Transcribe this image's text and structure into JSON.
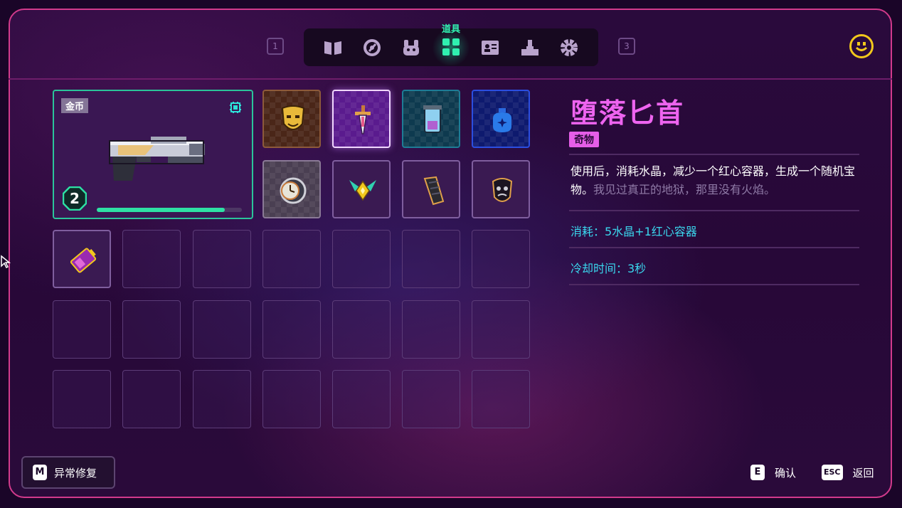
{
  "nav": {
    "left_key": "1",
    "right_key": "3",
    "active_tab_label": "道具",
    "tabs": [
      {
        "icon": "book-icon"
      },
      {
        "icon": "gauge-icon"
      },
      {
        "icon": "pet-icon"
      },
      {
        "icon": "items-grid-icon",
        "active": true
      },
      {
        "icon": "profile-card-icon"
      },
      {
        "icon": "podium-icon"
      },
      {
        "icon": "gear-icon"
      }
    ],
    "active_color": "#30f0b0"
  },
  "weapon": {
    "currency_label": "金币",
    "level": "2",
    "progress": 0.88,
    "border_color": "#2bc49a"
  },
  "inventory": {
    "items": [
      {
        "icon": "gold-mask-icon"
      },
      {
        "icon": "fallen-dagger-icon",
        "selected": true
      },
      {
        "icon": "crystal-jar-icon"
      },
      {
        "icon": "blue-pouch-icon"
      },
      {
        "icon": "pocket-watch-icon"
      },
      {
        "icon": "winged-gem-icon"
      },
      {
        "icon": "ammo-magazine-icon"
      },
      {
        "icon": "dark-mask-icon"
      },
      {
        "icon": "purple-battery-icon"
      }
    ]
  },
  "details": {
    "title": "堕落匕首",
    "rarity": "奇物",
    "description": "使用后，消耗水晶，减少一个红心容器，生成一个随机宝物。",
    "flavor": "我见过真正的地狱，那里没有火焰。",
    "cost": "消耗：5水晶+1红心容器",
    "cooldown": "冷却时间：3秒",
    "title_color": "#ee64f0",
    "stat_color": "#3ad7ee"
  },
  "footer": {
    "repair_key": "M",
    "repair_label": "异常修复",
    "confirm_key": "E",
    "confirm_label": "确认",
    "back_key": "ESC",
    "back_label": "返回"
  }
}
